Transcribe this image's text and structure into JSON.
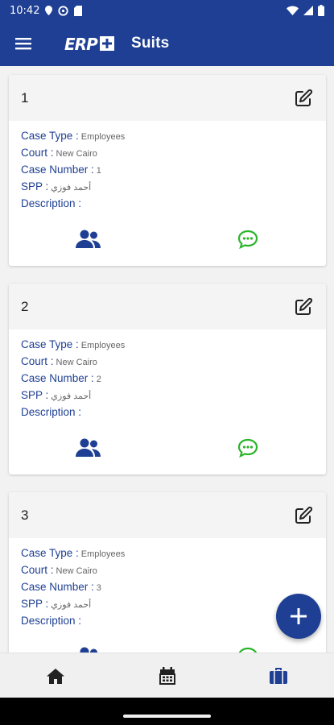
{
  "status_bar": {
    "time": "10:42"
  },
  "app_bar": {
    "title": "Suits",
    "logo_text": "ERP"
  },
  "labels": {
    "case_type": "Case Type :",
    "court": "Court :",
    "case_number": "Case Number :",
    "spp": "SPP :",
    "description": "Description :"
  },
  "cards": [
    {
      "number": "1",
      "case_type": "Employees",
      "court": "New Cairo",
      "case_number": "1",
      "spp": "أحمد فوزي",
      "description": ""
    },
    {
      "number": "2",
      "case_type": "Employees",
      "court": "New Cairo",
      "case_number": "2",
      "spp": "أحمد فوزي",
      "description": ""
    },
    {
      "number": "3",
      "case_type": "Employees",
      "court": "New Cairo",
      "case_number": "3",
      "spp": "أحمد فوزي",
      "description": ""
    }
  ],
  "icons": {
    "menu": "menu-icon",
    "edit": "edit-icon",
    "team": "team-icon",
    "chat": "chat-icon",
    "add": "plus-icon",
    "home": "home-icon",
    "calendar": "calendar-icon",
    "suits": "briefcase-icon"
  },
  "colors": {
    "primary": "#1e3f93",
    "accent_green": "#2bb52b",
    "label": "#1e3f93",
    "value": "#666666"
  },
  "bottom_nav": {
    "active": "suits"
  }
}
